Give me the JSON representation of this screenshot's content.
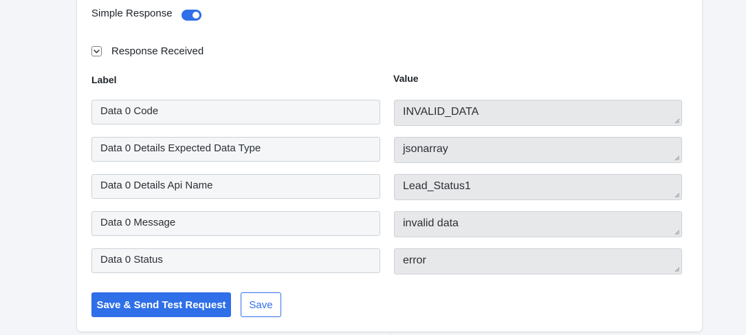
{
  "simple_response": {
    "label": "Simple Response",
    "enabled": true
  },
  "response_received": {
    "label": "Response Received",
    "expanded": true
  },
  "columns": {
    "label_header": "Label",
    "value_header": "Value"
  },
  "rows": [
    {
      "label": "Data 0 Code",
      "value": "INVALID_DATA"
    },
    {
      "label": "Data 0 Details Expected Data Type",
      "value": "jsonarray"
    },
    {
      "label": "Data 0 Details Api Name",
      "value": "Lead_Status1"
    },
    {
      "label": "Data 0 Message",
      "value": "invalid data"
    },
    {
      "label": "Data 0 Status",
      "value": "error"
    }
  ],
  "buttons": {
    "primary": "Save & Send Test Request",
    "secondary": "Save"
  },
  "colors": {
    "accent": "#2f6fe8"
  }
}
